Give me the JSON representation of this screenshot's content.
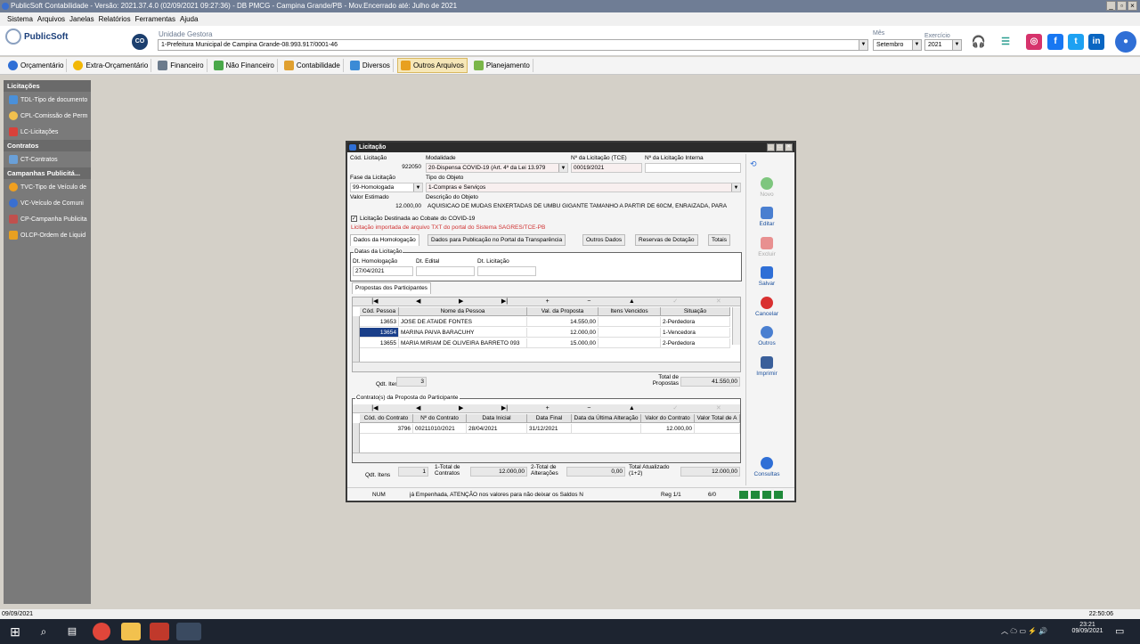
{
  "app": {
    "title": "PublicSoft Contabilidade - Versão: 2021.37.4.0 (02/09/2021 09:27:36) - DB PMCG - Campina Grande/PB - Mov.Encerrado até: Julho de 2021"
  },
  "menu": [
    "Sistema",
    "Arquivos",
    "Janelas",
    "Relatórios",
    "Ferramentas",
    "Ajuda"
  ],
  "header": {
    "logo": "PublicSoft",
    "badge": "CO",
    "unidade_label": "Unidade Gestora",
    "unidade_value": "1-Prefeitura Municipal de Campina Grande-08.993.917/0001-46",
    "mes_label": "Mês",
    "mes_value": "Setembro",
    "exercicio_label": "Exercício",
    "exercicio_value": "2021"
  },
  "toolbar": [
    "Orçamentário",
    "Extra-Orçamentário",
    "Financeiro",
    "Não Financeiro",
    "Contabilidade",
    "Diversos",
    "Outros Arquivos",
    "Planejamento"
  ],
  "sidebar": {
    "groups": [
      {
        "title": "Licitações",
        "items": [
          "TDL-Tipo de documento",
          "CPL-Comissão de Perm",
          "LC-Licitações"
        ]
      },
      {
        "title": "Contratos",
        "items": [
          "CT-Contratos"
        ]
      },
      {
        "title": "Campanhas Publicitá...",
        "items": [
          "TVC-Tipo de Veículo de",
          "VC-Veículo de Comuni",
          "CP-Campanha Publicita",
          "OLCP-Ordem de Liquid"
        ]
      }
    ]
  },
  "status": {
    "left": "09/09/2021",
    "right": "22:50:06"
  },
  "taskbar": {
    "time": "23:21",
    "date": "09/09/2021"
  },
  "dialog": {
    "title": "Licitação",
    "cod_label": "Cód. Licitação",
    "cod_value": "922050",
    "modalidade_label": "Modalidade",
    "modalidade_value": "20-Dispensa COVID-19 (Art. 4º da Lei 13.979",
    "num_tce_label": "Nº da Licitação (TCE)",
    "num_tce_value": "00019/2021",
    "num_interna_label": "Nº da Licitação Interna",
    "num_interna_value": "",
    "fase_label": "Fase da Licitação",
    "fase_value": "99-Homologada",
    "tipo_label": "Tipo do Objeto",
    "tipo_value": "1-Compras e Serviços",
    "valor_label": "Valor Estimado",
    "valor_value": "12.000,00",
    "desc_label": "Descrição do Objeto",
    "desc_value": "AQUISICAO DE   MUDAS ENXERTADAS DE UMBU GIGANTE TAMANHO A PARTIR DE 60CM, ENRAIZADA, PARA",
    "covid_label": "Licitação Destinada ao Cobate do COVID-19",
    "warning": "Licitação importada de arquivo TXT do portal do Sistema SAGRES/TCE-PB",
    "tabs": [
      "Dados da Homologação",
      "Dados para Publicação no Portal da Transparência",
      "Outros Dados",
      "Reservas de Dotação",
      "Totais"
    ],
    "datas_legend": "Datas da Licitação",
    "dt_homolog_label": "Dt. Homologação",
    "dt_homolog_value": "27/04/2021",
    "dt_edital_label": "Dt. Edital",
    "dt_edital_value": "",
    "dt_licit_label": "Dt. Licitação",
    "dt_licit_value": "",
    "propostas_tab": "Propostas dos Participantes",
    "nav": [
      "|◀",
      "◀",
      "▶",
      "▶|",
      "+",
      "−",
      "▲",
      "✓",
      "✕"
    ],
    "prop_headers": [
      "Cód. Pessoa",
      "Nome da Pessoa",
      "Val. da Proposta",
      "Itens Vencidos",
      "Situação"
    ],
    "prop_rows": [
      [
        "13653",
        "JOSE DE ATAIDE FONTES",
        "14.550,00",
        "",
        "2-Perdedora"
      ],
      [
        "13654",
        "MARINA PAIVA BARACUHY",
        "12.000,00",
        "",
        "1-Vencedora"
      ],
      [
        "13655",
        "MARIA MIRIAM DE OLIVEIRA BARRETO 093",
        "15.000,00",
        "",
        "2-Perdedora"
      ]
    ],
    "qtd_itens_label": "Qdt. Itens",
    "qtd_itens_value": "3",
    "total_prop_label": "Total de Propostas",
    "total_prop_value": "41.550,00",
    "contratos_legend": "Contrato(s) da Proposta do Participante",
    "ct_headers": [
      "Cód. do Contrato",
      "Nº do Contrato",
      "Data Inicial",
      "Data Final",
      "Data da Última Alteração",
      "Valor do Contrato",
      "Valor Total de A"
    ],
    "ct_rows": [
      [
        "3796",
        "00211010/2021",
        "28/04/2021",
        "31/12/2021",
        "",
        "12.000,00",
        ""
      ]
    ],
    "ct_qtd_label": "Qdt. Itens",
    "ct_qtd_value": "1",
    "total_ct_label": "1-Total de Contratos",
    "total_ct_value": "12.000,00",
    "total_alt_label": "2-Total de Alterações",
    "total_alt_value": "0,00",
    "total_atual_label": "Total Atualizado (1+2)",
    "total_atual_value": "12.000,00",
    "footer_num": "NUM",
    "footer_msg": "já Empenhada, ATENÇÃO nos valores para não deixar os Saldos N",
    "footer_reg": "Reg 1/1",
    "footer_count": "6/0",
    "buttons": [
      "Novo",
      "Editar",
      "Excluir",
      "Salvar",
      "Cancelar",
      "Outros",
      "Imprimir",
      "Consultas"
    ]
  },
  "colors": {
    "active_tab": "#f6e7b8",
    "sidebar": "#7a7a7a",
    "winbar": "#2b2b2b"
  }
}
